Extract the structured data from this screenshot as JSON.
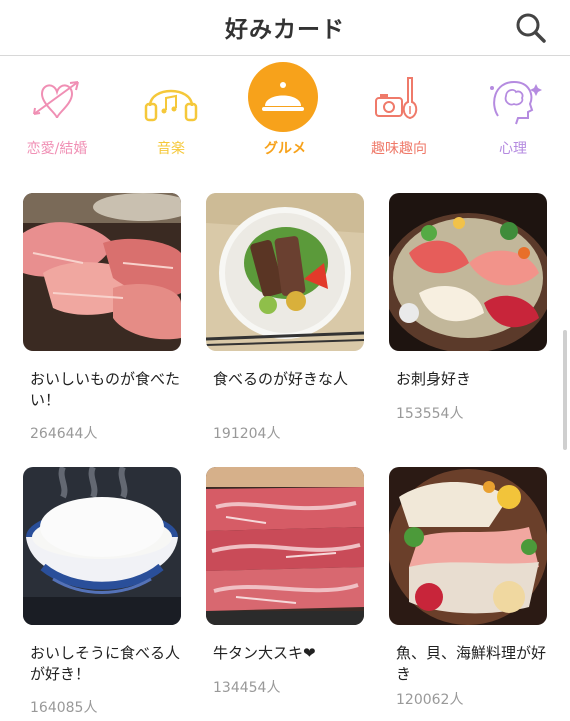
{
  "header": {
    "title": "好みカード",
    "search_icon": "search-icon"
  },
  "categories": [
    {
      "label": "恋愛/結婚",
      "icon": "heart-arrow-icon",
      "color": "#f08fb4",
      "active": false
    },
    {
      "label": "音楽",
      "icon": "headphones-icon",
      "color": "#f5c83a",
      "active": false
    },
    {
      "label": "グルメ",
      "icon": "cloche-icon",
      "color": "#f7a21b",
      "active": true
    },
    {
      "label": "趣味趣向",
      "icon": "camera-guitar-icon",
      "color": "#ef7a6a",
      "active": false
    },
    {
      "label": "心理",
      "icon": "brain-head-icon",
      "color": "#b58be0",
      "active": false
    }
  ],
  "cards": [
    {
      "title": "おいしいものが食べたい！",
      "count": "264644人",
      "image": "raw-tuna-photo"
    },
    {
      "title": "食べるのが好きな人",
      "count": "191204人",
      "image": "steak-plate-photo"
    },
    {
      "title": "お刺身好き",
      "count": "153554人",
      "image": "sashimi-platter-photo"
    },
    {
      "title": "おいしそうに食べる人が好き！",
      "count": "164085人",
      "image": "rice-bowl-photo"
    },
    {
      "title": "牛タン大スキ❤",
      "count": "134454人",
      "image": "beef-tongue-photo"
    },
    {
      "title": "魚、貝、海鮮料理が好き",
      "count": "120062人",
      "image": "seafood-platter-photo"
    }
  ]
}
